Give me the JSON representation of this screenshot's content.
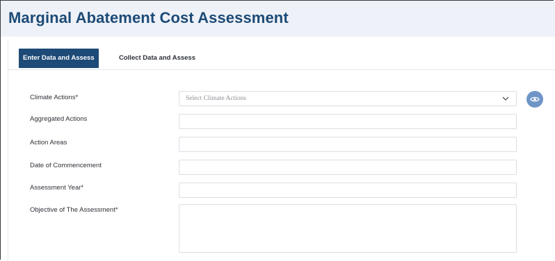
{
  "header": {
    "title": "Marginal Abatement Cost Assessment"
  },
  "tabs": [
    {
      "label": "Enter Data and Assess",
      "active": true
    },
    {
      "label": "Collect Data and Assess",
      "active": false
    }
  ],
  "form": {
    "climate_actions": {
      "label": "Climate Actions*",
      "placeholder": "Select Climate Actions"
    },
    "aggregated_actions": {
      "label": "Aggregated Actions",
      "value": ""
    },
    "action_areas": {
      "label": "Action Areas",
      "value": ""
    },
    "date_of_commencement": {
      "label": "Date of Commencement",
      "value": ""
    },
    "assessment_year": {
      "label": "Assessment Year*",
      "value": ""
    },
    "objective": {
      "label": "Objective of The Assessment*",
      "value": ""
    }
  },
  "icons": {
    "eye_button": "eye-icon",
    "dropdown": "chevron-down-icon"
  },
  "colors": {
    "brand": "#1d4a76",
    "header_bg": "#eef2f8",
    "eye_button_bg": "#6f95c7",
    "field_border": "#d9dde3"
  }
}
